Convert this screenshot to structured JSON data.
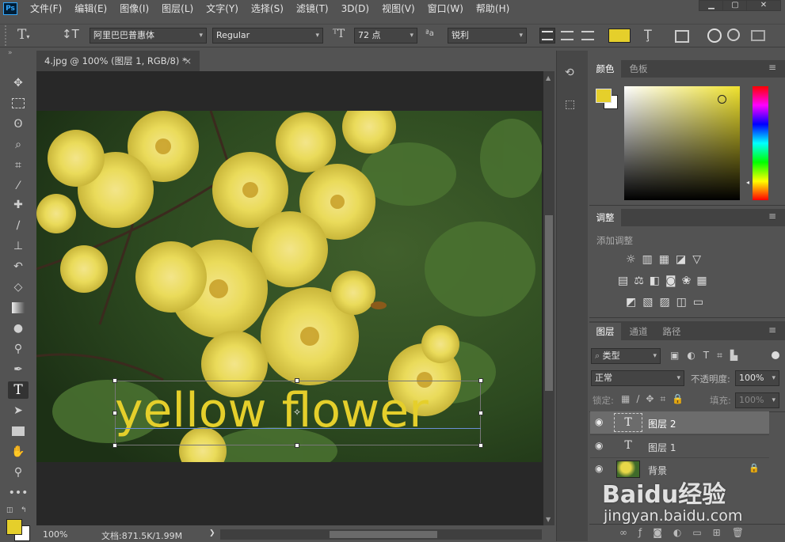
{
  "app": {
    "logo": "Ps"
  },
  "menu": [
    "文件(F)",
    "编辑(E)",
    "图像(I)",
    "图层(L)",
    "文字(Y)",
    "选择(S)",
    "滤镜(T)",
    "3D(D)",
    "视图(V)",
    "窗口(W)",
    "帮助(H)"
  ],
  "window_controls": {
    "minimize": "▁",
    "maximize": "▢",
    "close": "✕"
  },
  "options": {
    "font_family": "阿里巴巴普惠体",
    "font_style": "Regular",
    "font_size": "72 点",
    "antialias": "锐利",
    "text_color": "#e5cf2b"
  },
  "document": {
    "tab_title": "4.jpg @ 100% (图层 1, RGB/8) *",
    "close": "×",
    "text_layer": "yellow flower"
  },
  "status": {
    "zoom": "100%",
    "doc_size": "文档:871.5K/1.99M",
    "arrow": "❯"
  },
  "color_panel": {
    "tabs": [
      "颜色",
      "色板"
    ],
    "foreground": "#e5cf2b",
    "background": "#ffffff"
  },
  "adjust_panel": {
    "tab": "调整",
    "title": "添加调整"
  },
  "layers_panel": {
    "tabs": [
      "图层",
      "通道",
      "路径"
    ],
    "filter_kind": "类型",
    "blend_mode": "正常",
    "opacity_label": "不透明度:",
    "opacity_value": "100%",
    "lock_label": "锁定:",
    "fill_label": "填充:",
    "fill_value": "100%",
    "layers": [
      {
        "name": "图层 2",
        "kind": "text",
        "selected": true
      },
      {
        "name": "图层 1",
        "kind": "text",
        "selected": false
      },
      {
        "name": "背景",
        "kind": "image",
        "selected": false
      }
    ]
  },
  "watermark": {
    "brand": "Baidu经验",
    "url": "jingyan.baidu.com"
  }
}
